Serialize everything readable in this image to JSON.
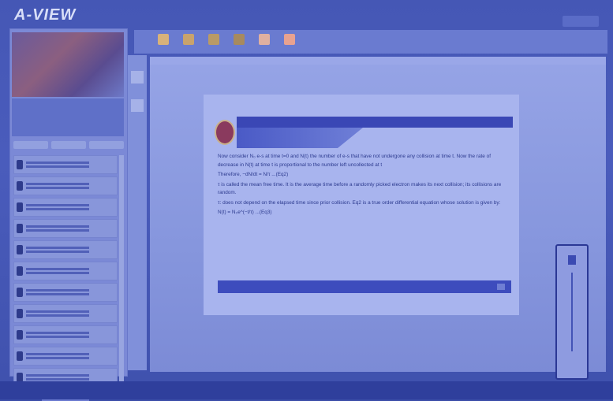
{
  "app": {
    "title": "A-VIEW"
  },
  "slide": {
    "paragraphs": [
      "Now consider N₀ e-s at time t=0 and N(t) the number of e-s that have not undergone any collision at time t. Now the rate of decrease in N(t) at time t is proportional to the number left uncollected at t",
      "Therefore, −dN/dt = N/τ ...(Eq2)",
      "τ is called the mean free time. It is the average time before a randomly picked electron makes its next collision; its collisions are random.",
      "τ: does not depend on the elapsed time since prior collision. Eq2 is a true order differential equation whose solution is given by:",
      "N(t) = N₀e^(−t/τ) ...(Eq3)"
    ]
  },
  "sidebar": {
    "users_count": 12
  },
  "colors": {
    "accent": "#3a47b5",
    "frame": "#4557b5"
  }
}
